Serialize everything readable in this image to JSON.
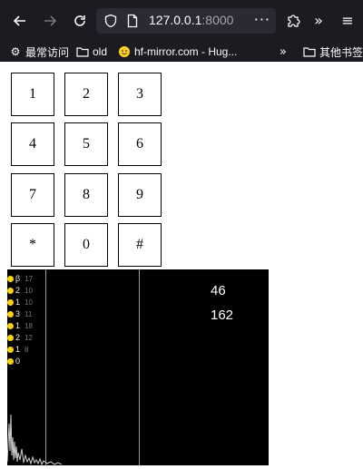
{
  "browser": {
    "back_icon": "arrow-left-icon",
    "forward_icon": "arrow-right-icon",
    "reload_icon": "reload-icon",
    "url_host": "127.0.0.1",
    "url_port": ":8000",
    "page_menu_label": "···",
    "extensions_icon": "puzzle-icon",
    "overflow_label": "»",
    "menu_label": "≡"
  },
  "bookmarks": {
    "items": [
      {
        "icon": "gear-icon",
        "label": "最常访问"
      },
      {
        "icon": "folder-icon",
        "label": "old"
      },
      {
        "icon": "hugging-face-icon",
        "label": "hf-mirror.com - Hug..."
      }
    ],
    "overflow_label": "»",
    "other_label": "其他书签"
  },
  "keypad": {
    "keys": [
      "1",
      "2",
      "3",
      "4",
      "5",
      "6",
      "7",
      "8",
      "9",
      "*",
      "0",
      "#"
    ]
  },
  "visualization": {
    "legend": [
      {
        "label": "β",
        "num": "17"
      },
      {
        "label": "2",
        "num": "10"
      },
      {
        "label": "1",
        "num": "10"
      },
      {
        "label": "3",
        "num": "11"
      },
      {
        "label": "1",
        "num": "18"
      },
      {
        "label": "2",
        "num": "12"
      },
      {
        "label": "1",
        "num": "8"
      },
      {
        "label": "0",
        "num": ""
      }
    ],
    "stat_top": "46",
    "stat_bottom": "162",
    "colors": {
      "background": "#000000",
      "dot": "#ffd400",
      "line": "#9a9a9a"
    }
  }
}
